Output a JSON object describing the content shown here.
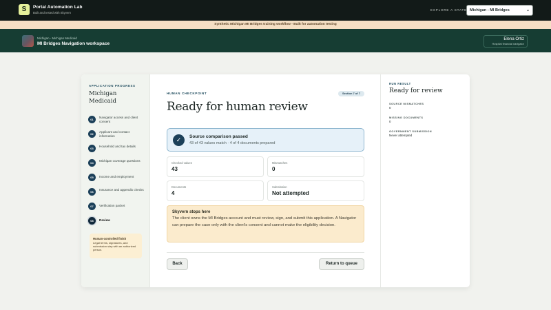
{
  "topbar": {
    "logo_letter": "S",
    "brand_title": "Portal Automation Lab",
    "brand_subtitle": "Built and tested with Skyvern",
    "explore_label": "EXPLORE A STATE",
    "state_select_value": "Michigan - MI Bridges"
  },
  "banner": {
    "text": "Synthetic Michigan MI Bridges training workflow - Built for automation testing"
  },
  "workspace": {
    "subtitle": "Michigan - Michigan Medicaid",
    "title": "MI Bridges Navigation workspace",
    "user_name": "Elena Ortiz",
    "user_role": "Hospital financial navigator"
  },
  "progress": {
    "label": "APPLICATION PROGRESS",
    "state_name": "Michigan Medicaid",
    "steps": [
      {
        "num": "01",
        "label": "Navigator access and client consent"
      },
      {
        "num": "02",
        "label": "Applicant and contact information"
      },
      {
        "num": "03",
        "label": "Household and tax details"
      },
      {
        "num": "04",
        "label": "Michigan coverage questions"
      },
      {
        "num": "05",
        "label": "Income and employment"
      },
      {
        "num": "06",
        "label": "Insurance and appendix checks"
      },
      {
        "num": "07",
        "label": "Verification packet"
      },
      {
        "num": "08",
        "label": "Review"
      }
    ],
    "note_title": "Human-controlled finish",
    "note_body": "Legal terms, signatures, and submission stay with an authorized person."
  },
  "main": {
    "eyebrow": "HUMAN CHECKPOINT",
    "section_pill": "Section 7 of 7",
    "heading": "Ready for human review",
    "success_title": "Source comparison passed",
    "success_sub": "43 of 43 values match · 4 of 4 documents prepared",
    "stats": [
      {
        "label": "Checked values",
        "value": "43"
      },
      {
        "label": "Mismatches",
        "value": "0"
      },
      {
        "label": "Documents",
        "value": "4"
      },
      {
        "label": "Submission",
        "value": "Not attempted"
      }
    ],
    "warn_title": "Skyvern stops here",
    "warn_body": "The client owns the MI Bridges account and must review, sign, and submit this application. A Navigator can prepare the case only with the client's consent and cannot make the eligibility decision.",
    "back_label": "Back",
    "queue_label": "Return to queue"
  },
  "result": {
    "eyebrow": "RUN RESULT",
    "title": "Ready for review",
    "items": [
      {
        "label": "SOURCE MISMATCHES",
        "value": "0"
      },
      {
        "label": "MISSING DOCUMENTS",
        "value": "0"
      },
      {
        "label": "GOVERNMENT SUBMISSION",
        "value": "Never attempted"
      }
    ]
  }
}
